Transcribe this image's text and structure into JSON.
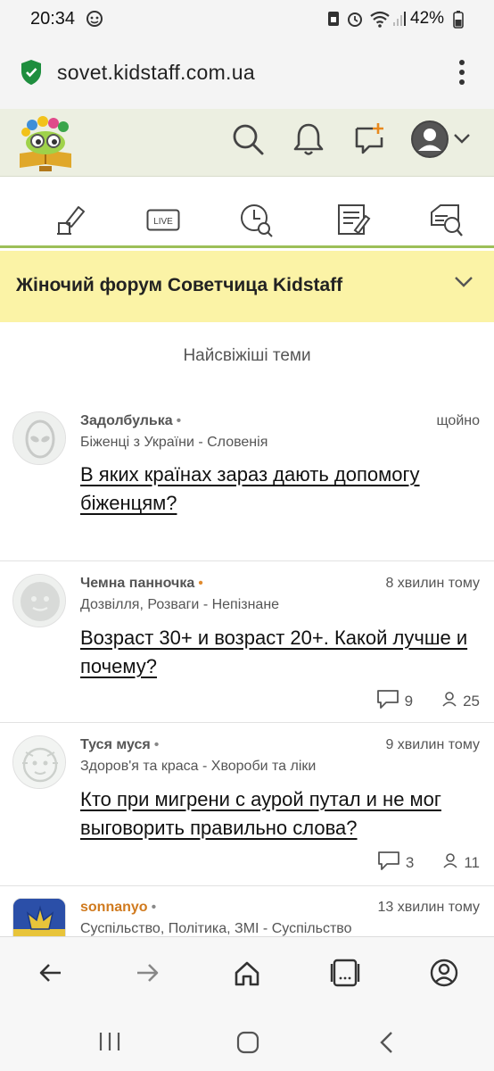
{
  "status_bar": {
    "time": "20:34",
    "battery": "42%"
  },
  "browser": {
    "url": "sovet.kidstaff.com.ua",
    "secure_icon": "shield-check-icon",
    "menu_icon": "kebab-menu-icon"
  },
  "header": {
    "logo_icon": "kidstaff-logo-icon",
    "actions": [
      "search-icon",
      "bell-icon",
      "new-message-icon",
      "user-avatar-icon",
      "chevron-down-icon"
    ]
  },
  "icon_nav": {
    "items": [
      "new-topic-icon",
      "live-icon",
      "recent-icon",
      "forum-list-icon",
      "search-box-icon"
    ],
    "live_label": "LIVE"
  },
  "forum": {
    "title": "Жіночий форум Советчица Kidstaff"
  },
  "section": {
    "title": "Найсвіжіші теми"
  },
  "topics": [
    {
      "author": "Задолбулька",
      "time": "щойно",
      "category": "Біженці з України - Словенія",
      "title": "В яких країнах зараз дають допомогу біженцям?",
      "replies": "",
      "views": ""
    },
    {
      "author": "Чемна панночка",
      "time": "8 хвилин тому",
      "category": "Дозвілля, Розваги - Непізнане",
      "title": "Возраст 30+ и возраст 20+. Какой лучше и почему?",
      "replies": "9",
      "views": "25"
    },
    {
      "author": "Туся муся",
      "time": "9 хвилин тому",
      "category": "Здоров'я та краса - Хвороби та ліки",
      "title": "Кто при мигрени с аурой путал и не мог выговорить правильно слова?",
      "replies": "3",
      "views": "11"
    },
    {
      "author": "sonnanyo",
      "time": "13 хвилин тому",
      "category": "Суспільство, Політика, ЗМІ - Суспільство",
      "title": "",
      "replies": "",
      "views": ""
    }
  ],
  "colors": {
    "header_bg": "#ecefe1",
    "banner_bg": "#fbf3a6",
    "accent_green": "#9cbf58",
    "orange": "#d07a1e"
  }
}
